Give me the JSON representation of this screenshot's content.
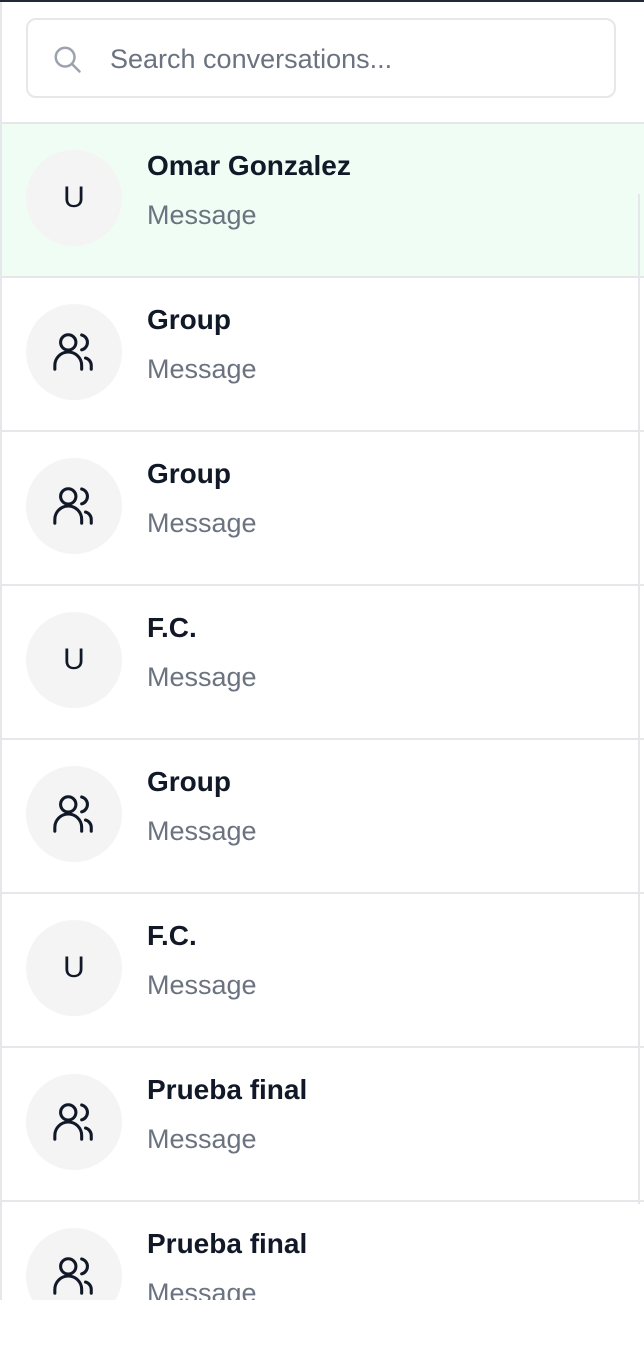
{
  "search": {
    "placeholder": "Search conversations...",
    "icon": "search-icon"
  },
  "colors": {
    "active_row": "#f0fdf4",
    "avatar_bg": "#f3f4f3",
    "name": "#111827",
    "preview": "#6b7280",
    "border": "#e5e7eb"
  },
  "conversations": [
    {
      "name": "Omar Gonzalez",
      "preview": "Message",
      "avatar": "U",
      "type": "user",
      "active": true
    },
    {
      "name": "Group",
      "preview": "Message",
      "type": "group",
      "icon": "users-icon"
    },
    {
      "name": "Group",
      "preview": "Message",
      "type": "group",
      "icon": "users-icon"
    },
    {
      "name": "F.C.",
      "preview": "Message",
      "avatar": "U",
      "type": "user"
    },
    {
      "name": "Group",
      "preview": "Message",
      "type": "group",
      "icon": "users-icon"
    },
    {
      "name": "F.C.",
      "preview": "Message",
      "avatar": "U",
      "type": "user"
    },
    {
      "name": "Prueba final",
      "preview": "Message",
      "type": "group",
      "icon": "users-icon"
    },
    {
      "name": "Prueba final",
      "preview": "Message",
      "type": "group",
      "icon": "users-icon"
    }
  ]
}
